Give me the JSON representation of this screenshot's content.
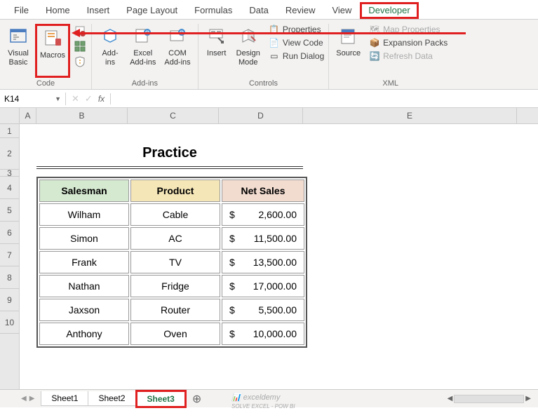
{
  "tabs": [
    "File",
    "Home",
    "Insert",
    "Page Layout",
    "Formulas",
    "Data",
    "Review",
    "View",
    "Developer"
  ],
  "activeTab": 8,
  "ribbon": {
    "code": {
      "label": "Code",
      "vb": "Visual\nBasic",
      "macros": "Macros"
    },
    "addins": {
      "label": "Add-ins",
      "addins": "Add-\nins",
      "excel": "Excel\nAdd-ins",
      "com": "COM\nAdd-ins"
    },
    "controls": {
      "label": "Controls",
      "insert": "Insert",
      "design": "Design\nMode",
      "props": "Properties",
      "view": "View Code",
      "run": "Run Dialog"
    },
    "xml": {
      "label": "XML",
      "source": "Source",
      "map": "Map Properties",
      "exp": "Expansion Packs",
      "refresh": "Refresh Data"
    }
  },
  "nameBox": "K14",
  "fx": "fx",
  "colHeaders": [
    "A",
    "B",
    "C",
    "D",
    "E"
  ],
  "rowHeaders": [
    "1",
    "2",
    "3",
    "4",
    "5",
    "6",
    "7",
    "8",
    "9",
    "10"
  ],
  "title": "Practice",
  "table": {
    "headers": {
      "salesman": "Salesman",
      "product": "Product",
      "netsales": "Net Sales"
    },
    "rows": [
      {
        "s": "Wilham",
        "p": "Cable",
        "n": "2,600.00"
      },
      {
        "s": "Simon",
        "p": "AC",
        "n": "11,500.00"
      },
      {
        "s": "Frank",
        "p": "TV",
        "n": "13,500.00"
      },
      {
        "s": "Nathan",
        "p": "Fridge",
        "n": "17,000.00"
      },
      {
        "s": "Jaxson",
        "p": "Router",
        "n": "5,500.00"
      },
      {
        "s": "Anthony",
        "p": "Oven",
        "n": "10,000.00"
      }
    ],
    "curr": "$"
  },
  "sheets": [
    "Sheet1",
    "Sheet2",
    "Sheet3"
  ],
  "activeSheet": 2,
  "watermark": {
    "main": "exceldemy",
    "sub": "SOLVE EXCEL - POW BI"
  }
}
